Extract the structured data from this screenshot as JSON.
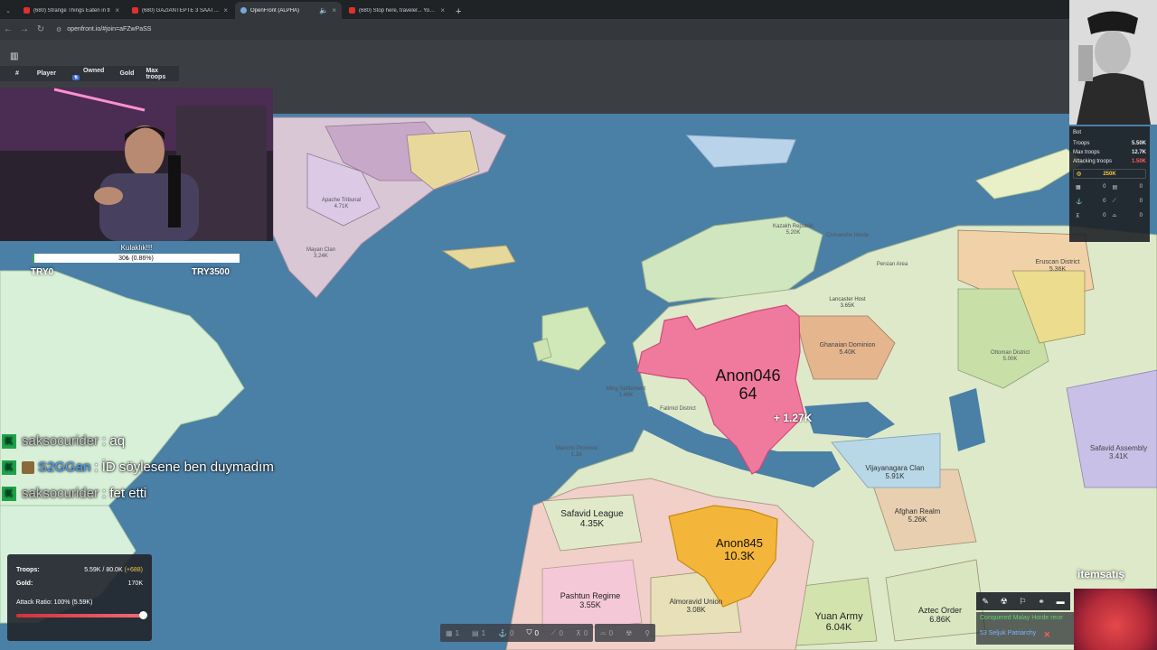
{
  "browser": {
    "tabs": [
      {
        "title": "(680) Strange Things Eaten in tl",
        "active": false
      },
      {
        "title": "(680) GAZİANTEPTE 3 SAATTE",
        "active": false
      },
      {
        "title": "OpenFront (ALPHA)",
        "active": true
      },
      {
        "title": "(680) Stop here, traveler... You d",
        "active": false
      }
    ],
    "url": "openfront.io/#join=aFZwPaSS"
  },
  "leaderboard": {
    "col_rank": "#",
    "col_player": "Player",
    "col_owned": "Owned",
    "col_gold": "Gold",
    "col_max_troops": "Max troops"
  },
  "donation": {
    "label": "Kulaklık!!!",
    "progress_text": "30₺ (0.86%)",
    "progress_fraction": 0.0086,
    "min": "TRY0",
    "max": "TRY3500"
  },
  "player_info": {
    "name": "Bot",
    "troops_label": "Troops",
    "troops": "5.50K",
    "max_troops_label": "Max troops",
    "max_troops": "12.7K",
    "attacking_label": "Attacking troops",
    "attacking": "1.50K",
    "gold": "250K",
    "counts": [
      "0",
      "0",
      "0",
      "0",
      "0",
      "0"
    ]
  },
  "chat": [
    {
      "user": "saksocurider",
      "text": ": aq"
    },
    {
      "user": "S2GGan",
      "text": ": İD söylesene ben duymadım"
    },
    {
      "user": "saksocurider",
      "text": ": fet etti"
    }
  ],
  "troops_panel": {
    "troops_label": "Troops:",
    "troops_value": "5.59K / 80.0K",
    "troops_plus": "(+688)",
    "gold_label": "Gold:",
    "gold_value": "170K",
    "ratio_label": "Attack Ratio: 100% (5.59K)",
    "ratio_fraction": 1.0
  },
  "buildbar": {
    "items": [
      "1",
      "1",
      "0",
      "0",
      "0",
      "0",
      "0"
    ]
  },
  "events": {
    "line1": "Conquered Malay Horde rece",
    "line2": "53 Seljuk Patriarchy"
  },
  "brand": "itemsatış",
  "map": {
    "labels": [
      {
        "name": "Anon046",
        "sub": "64"
      },
      {
        "name": "Anon845",
        "sub": "10.3K"
      },
      {
        "name": "Safavid League",
        "sub": "4.35K"
      },
      {
        "name": "Yuan Army",
        "sub": "6.04K"
      },
      {
        "name": "Aztec Order",
        "sub": "6.86K"
      },
      {
        "name": "Pashtun Regime",
        "sub": "3.55K"
      },
      {
        "name": "Almoravid Union",
        "sub": "3.08K"
      },
      {
        "name": "Afghan Realm",
        "sub": "5.26K"
      },
      {
        "name": "Vijayanagara Clan",
        "sub": "5.91K"
      },
      {
        "name": "Ghanaian Dominion",
        "sub": "5.40K"
      },
      {
        "name": "Lancaster Host",
        "sub": "3.65K"
      },
      {
        "name": "Eruscan District",
        "sub": "5.36K"
      },
      {
        "name": "Safavid Assembly",
        "sub": "3.41K"
      },
      {
        "name": "Manchu Province",
        "sub": "1.1K"
      },
      {
        "name": "Ming Settlement",
        "sub": "1.46K"
      },
      {
        "name": "Fatimid District",
        "sub": ""
      },
      {
        "name": "Mayan Clan",
        "sub": "3.24K"
      },
      {
        "name": "Apache Tribunal",
        "sub": "4.71K"
      },
      {
        "name": "Ottoman District",
        "sub": "5.00K"
      },
      {
        "name": "Persian Area",
        "sub": ""
      },
      {
        "name": "Kazakh Republic",
        "sub": "5.20K"
      },
      {
        "name": "Comanche Horde",
        "sub": ""
      }
    ],
    "attack_float": "+ 1.27K"
  }
}
